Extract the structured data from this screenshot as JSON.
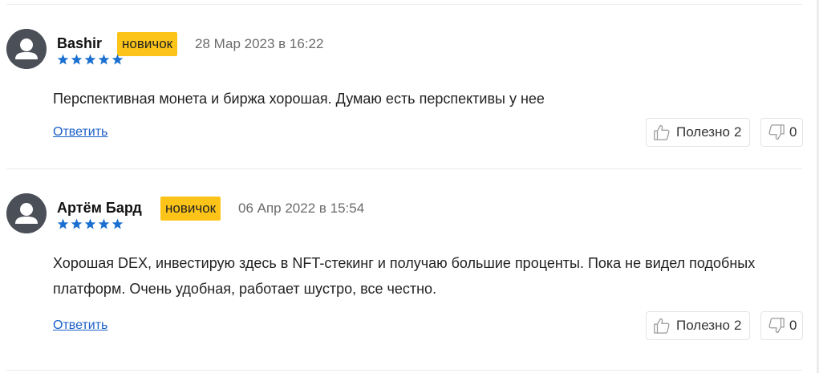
{
  "comments": [
    {
      "author": "Bashir",
      "badge": "новичок",
      "date": "28 Мар 2023 в 16:22",
      "rating": 5,
      "text": "Перспективная монета и биржа хорошая. Думаю есть перспективы у нее",
      "reply_label": "Ответить",
      "like_label": "Полезно",
      "likes": "2",
      "dislikes": "0"
    },
    {
      "author": "Артём Бард",
      "badge": "новичок",
      "date": "06 Апр 2022 в 15:54",
      "rating": 5,
      "text": "Хорошая DEX, инвестирую здесь в NFT-стекинг и получаю большие проценты. Пока не видел подобных платформ. Очень удобная, работает шустро, все честно.",
      "reply_label": "Ответить",
      "like_label": "Полезно",
      "likes": "2",
      "dislikes": "0"
    }
  ],
  "colors": {
    "badge": "#fcc419",
    "stars": "#1a6fd1",
    "link": "#1a5fc7",
    "avatar": "#4b5058"
  },
  "icons": {
    "like": "thumbs-up-icon",
    "dislike": "thumbs-down-icon",
    "avatar": "user-silhouette-icon",
    "star": "star-icon"
  }
}
